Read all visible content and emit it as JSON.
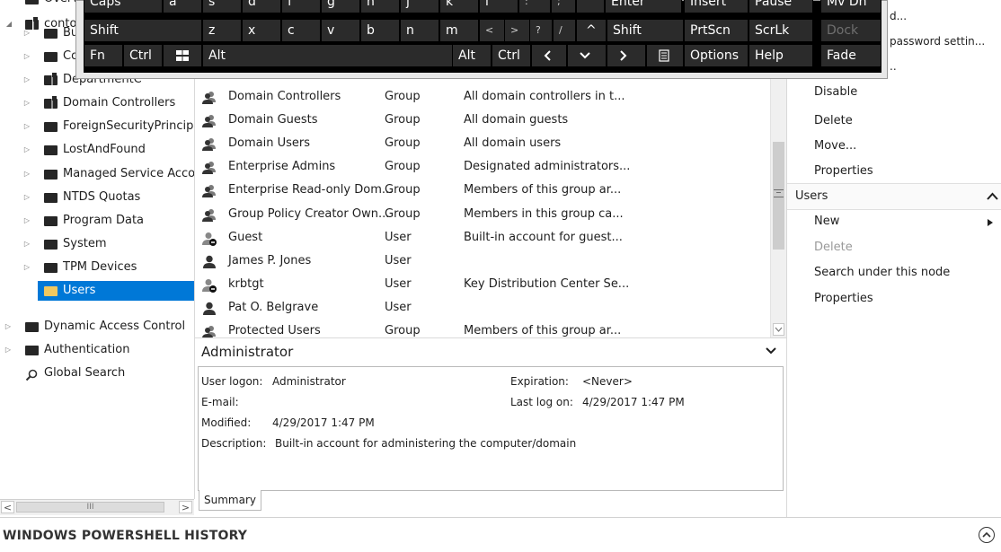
{
  "tree": {
    "partial_top_item": "Overv",
    "root_label": "contos",
    "children": [
      {
        "label": "Bu",
        "icon": "folder-icon"
      },
      {
        "label": "Co",
        "icon": "folder-icon"
      },
      {
        "label": "DepartmentC",
        "icon": "ou-folder-icon"
      },
      {
        "label": "Domain Controllers",
        "icon": "ou-folder-icon"
      },
      {
        "label": "ForeignSecurityPrincipals",
        "icon": "folder-icon"
      },
      {
        "label": "LostAndFound",
        "icon": "folder-icon"
      },
      {
        "label": "Managed Service Accoun",
        "icon": "folder-icon"
      },
      {
        "label": "NTDS Quotas",
        "icon": "folder-icon"
      },
      {
        "label": "Program Data",
        "icon": "folder-icon"
      },
      {
        "label": "System",
        "icon": "folder-icon"
      },
      {
        "label": "TPM Devices",
        "icon": "folder-icon"
      },
      {
        "label": "Users",
        "icon": "folder-icon",
        "selected": true
      }
    ],
    "top_items": [
      {
        "label": "Dynamic Access Control",
        "icon": "folder-icon"
      },
      {
        "label": "Authentication",
        "icon": "folder-icon"
      },
      {
        "label": "Global Search",
        "icon": "search-icon"
      }
    ],
    "scroll_glyphs": {
      "left": "<",
      "thumb": "III",
      "right": ">"
    }
  },
  "list": {
    "rows": [
      {
        "name": "Domain Controllers",
        "type": "Group",
        "description": "All domain controllers in t...",
        "icon": "group-icon"
      },
      {
        "name": "Domain Guests",
        "type": "Group",
        "description": "All domain guests",
        "icon": "group-icon"
      },
      {
        "name": "Domain Users",
        "type": "Group",
        "description": "All domain users",
        "icon": "group-icon"
      },
      {
        "name": "Enterprise Admins",
        "type": "Group",
        "description": "Designated administrators...",
        "icon": "group-icon"
      },
      {
        "name": "Enterprise Read-only Dom...",
        "type": "Group",
        "description": "Members of this group ar...",
        "icon": "group-icon"
      },
      {
        "name": "Group Policy Creator Own...",
        "type": "Group",
        "description": "Members in this group ca...",
        "icon": "group-icon"
      },
      {
        "name": "Guest",
        "type": "User",
        "description": "Built-in account for guest...",
        "icon": "disabled-user-icon"
      },
      {
        "name": "James P. Jones",
        "type": "User",
        "description": "",
        "icon": "user-icon"
      },
      {
        "name": "krbtgt",
        "type": "User",
        "description": "Key Distribution Center Se...",
        "icon": "disabled-user-icon"
      },
      {
        "name": "Pat O. Belgrave",
        "type": "User",
        "description": "",
        "icon": "user-icon"
      },
      {
        "name": "Protected Users",
        "type": "Group",
        "description": "Members of this group ar...",
        "icon": "group-icon"
      }
    ]
  },
  "details": {
    "title": "Administrator",
    "user_logon_label": "User logon:",
    "user_logon_value": "Administrator",
    "email_label": "E-mail:",
    "modified_label": "Modified:",
    "modified_value": "4/29/2017 1:47 PM",
    "description_label": "Description:",
    "description_value": "Built-in account for administering the computer/domain",
    "expiration_label": "Expiration:",
    "expiration_value": "<Never>",
    "last_logon_label": "Last log on:",
    "last_logon_value": "4/29/2017 1:47 PM",
    "tab_summary": "Summary"
  },
  "tasks": {
    "partial_top_1": "d...",
    "partial_top_2": "password settin...",
    "partial_top_3": "..",
    "admin_tasks": [
      "Disable",
      "Delete",
      "Move...",
      "Properties"
    ],
    "users_header": "Users",
    "users_tasks": [
      {
        "label": "New",
        "disabled": false,
        "submenu": true
      },
      {
        "label": "Delete",
        "disabled": true,
        "submenu": false
      },
      {
        "label": "Search under this node",
        "disabled": false,
        "submenu": false
      },
      {
        "label": "Properties",
        "disabled": false,
        "submenu": false
      }
    ]
  },
  "powershell": {
    "title": "WINDOWS POWERSHELL HISTORY"
  },
  "keyboard": {
    "row1": [
      "Caps",
      "a",
      "s",
      "d",
      "f",
      "g",
      "h",
      "j",
      "k",
      "l",
      ":",
      ";",
      "'",
      "Enter",
      "Insert",
      "Pause",
      "Mv Dn"
    ],
    "row2": [
      "Shift",
      "z",
      "x",
      "c",
      "v",
      "b",
      "n",
      "m",
      "<",
      ">",
      "?",
      "/",
      "^",
      "Shift",
      "PrtScn",
      "ScrLk",
      "Dock"
    ],
    "row3": [
      "Fn",
      "Ctrl",
      "Win",
      "Alt",
      "Alt",
      "Ctrl",
      "<",
      "v",
      ">",
      "Menu",
      "Options",
      "Help",
      "Fade"
    ]
  },
  "colors": {
    "selection": "#0078d7",
    "key_bg": "#2b2b2b",
    "icon_dark": "#262626"
  }
}
